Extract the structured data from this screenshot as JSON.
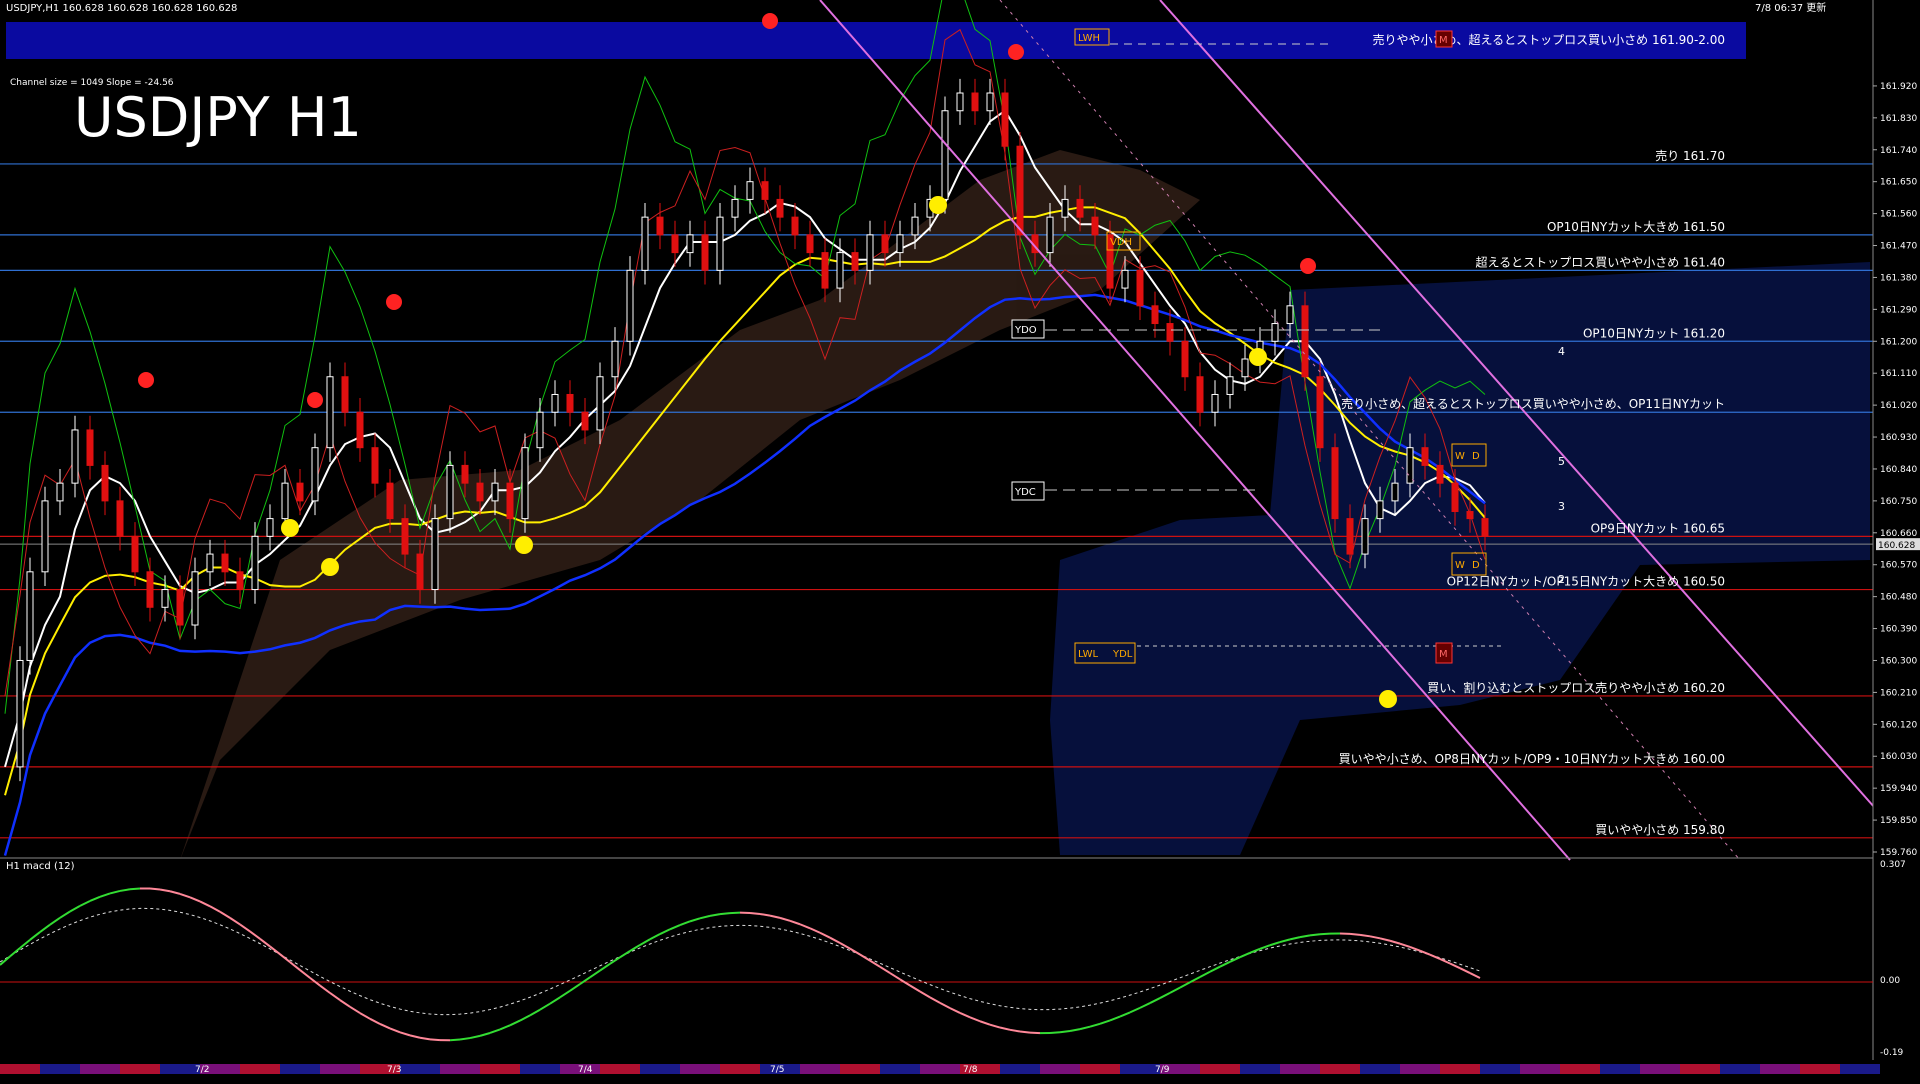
{
  "header": {
    "info": "USDJPY,H1  160.628 160.628 160.628 160.628",
    "datetime": "7/8 06:37 更新",
    "channel_info": "Channel size = 1049 Slope = -24.56",
    "big_title": "USDJPY H1",
    "macd_label": "H1  macd (12)"
  },
  "chart_data": [
    {
      "type": "candlestick",
      "symbol": "USDJPY",
      "timeframe": "H1",
      "ylim": [
        159.76,
        162.01
      ],
      "price_ticks": [
        "161.920",
        "161.830",
        "161.740",
        "161.650",
        "161.560",
        "161.470",
        "161.380",
        "161.290",
        "161.200",
        "161.110",
        "161.020",
        "160.930",
        "160.840",
        "160.750",
        "160.660",
        "160.570",
        "160.480",
        "160.390",
        "160.300",
        "160.210",
        "160.120",
        "160.030",
        "159.940",
        "159.850",
        "159.760"
      ],
      "current_price": "160.628",
      "levels": [
        {
          "label": "売りやや小さめ、超えるとストップロス買い小さめ 161.90-2.00",
          "value": 161.95,
          "kind": "band"
        },
        {
          "label": "売り 161.70",
          "value": 161.7
        },
        {
          "label": "OP10日NYカット大きめ 161.50",
          "value": 161.5
        },
        {
          "label": "超えるとストップロス買いやや小さめ 161.40",
          "value": 161.4
        },
        {
          "label": "OP10日NYカット 161.20",
          "value": 161.2
        },
        {
          "label": "売り小さめ、超えるとストップロス買いやや小さめ、OP11日NYカット",
          "value": 161.0
        },
        {
          "label": "OP9日NYカット 160.65",
          "value": 160.65
        },
        {
          "label": "OP12日NYカット/OP15日NYカット大きめ 160.50",
          "value": 160.5
        },
        {
          "label": "買い、割り込むとストップロス売りやや小さめ 160.20",
          "value": 160.2
        },
        {
          "label": "買いやや小さめ、OP8日NYカット/OP9・10日NYカット大きめ 160.00",
          "value": 160.0
        },
        {
          "label": "買いやや小さめ 159.80",
          "value": 159.8
        }
      ],
      "markers": [
        "LWH",
        "VDH",
        "LWL",
        "YDL",
        "YDO",
        "YDC",
        "W",
        "D",
        "M"
      ],
      "projection_labels": [
        "4",
        "5",
        "3",
        "2"
      ]
    },
    {
      "type": "line",
      "name": "macd (12)",
      "ylim": [
        -0.19,
        0.307
      ],
      "ticks": [
        "0.307",
        "0.00",
        "-0.19"
      ]
    }
  ],
  "dates": [
    "7/2",
    "7/3",
    "7/4",
    "7/5",
    "7/8",
    "7/9"
  ],
  "colors": {
    "bg": "#000000",
    "band": "#0a0aa0",
    "level_blue": "#2f6fd1",
    "level_red": "#cc1111",
    "ma_white": "#ffffff",
    "ma_yellow": "#ffee00",
    "ma_blue": "#1030ff",
    "channel": "#e070e0",
    "bull": "#ffffff",
    "bear": "#e01010"
  }
}
